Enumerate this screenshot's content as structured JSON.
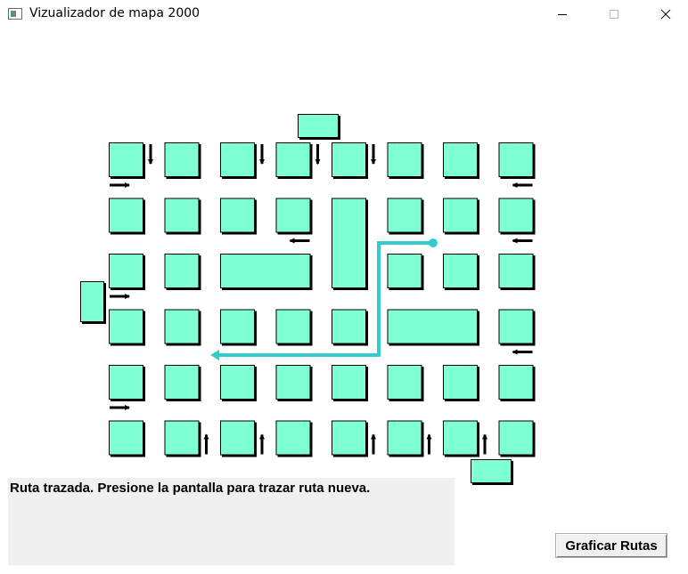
{
  "window": {
    "title": "Vizualizador de mapa 2000",
    "icon": "app-window-icon",
    "controls": [
      "minimize-icon",
      "maximize-icon",
      "close-icon"
    ]
  },
  "map": {
    "block_fill": "#7fffd4",
    "block_border": "#000000",
    "route_color": "#33cccc",
    "arrow_color": "#000000",
    "blocks": [
      {
        "id": "entrance-top",
        "c": [
          0.5,
          0.5
        ],
        "r": [
          -1,
          -1
        ]
      },
      {
        "id": "entrance-left",
        "c": [
          -0.5,
          -0.5
        ],
        "r": [
          2.5,
          3.5
        ]
      },
      {
        "id": "entrance-bottom",
        "c": [
          6.5,
          6.5
        ],
        "r": [
          6,
          6
        ]
      },
      {
        "id": "r0c0",
        "c": [
          0,
          0
        ],
        "r": [
          0,
          0
        ]
      },
      {
        "id": "r0c1",
        "c": [
          1,
          1
        ],
        "r": [
          0,
          0
        ]
      },
      {
        "id": "r0c2",
        "c": [
          2,
          2
        ],
        "r": [
          0,
          0
        ]
      },
      {
        "id": "r0c3",
        "c": [
          3,
          3
        ],
        "r": [
          0,
          0
        ]
      },
      {
        "id": "r0c4",
        "c": [
          4,
          4
        ],
        "r": [
          0,
          0
        ]
      },
      {
        "id": "r0c5",
        "c": [
          5,
          5
        ],
        "r": [
          0,
          0
        ]
      },
      {
        "id": "r0c6",
        "c": [
          6,
          6
        ],
        "r": [
          0,
          0
        ]
      },
      {
        "id": "r0c7",
        "c": [
          7,
          7
        ],
        "r": [
          0,
          0
        ]
      },
      {
        "id": "r1c0",
        "c": [
          0,
          0
        ],
        "r": [
          1,
          1
        ]
      },
      {
        "id": "r1c1",
        "c": [
          1,
          1
        ],
        "r": [
          1,
          1
        ]
      },
      {
        "id": "r1c2",
        "c": [
          2,
          2
        ],
        "r": [
          1,
          1
        ]
      },
      {
        "id": "r1c3",
        "c": [
          3,
          3
        ],
        "r": [
          1,
          1
        ]
      },
      {
        "id": "tall-c4",
        "c": [
          4,
          4
        ],
        "r": [
          1,
          2
        ]
      },
      {
        "id": "r1c5",
        "c": [
          5,
          5
        ],
        "r": [
          1,
          1
        ]
      },
      {
        "id": "r1c6",
        "c": [
          6,
          6
        ],
        "r": [
          1,
          1
        ]
      },
      {
        "id": "r1c7",
        "c": [
          7,
          7
        ],
        "r": [
          1,
          1
        ]
      },
      {
        "id": "r2c0",
        "c": [
          0,
          0
        ],
        "r": [
          2,
          2
        ]
      },
      {
        "id": "r2c1",
        "c": [
          1,
          1
        ],
        "r": [
          2,
          2
        ]
      },
      {
        "id": "wide-c2c3",
        "c": [
          2,
          3
        ],
        "r": [
          2,
          2
        ]
      },
      {
        "id": "r2c5",
        "c": [
          5,
          5
        ],
        "r": [
          2,
          2
        ]
      },
      {
        "id": "r2c6",
        "c": [
          6,
          6
        ],
        "r": [
          2,
          2
        ]
      },
      {
        "id": "r2c7",
        "c": [
          7,
          7
        ],
        "r": [
          2,
          2
        ]
      },
      {
        "id": "r3c0",
        "c": [
          0,
          0
        ],
        "r": [
          3,
          3
        ]
      },
      {
        "id": "r3c1",
        "c": [
          1,
          1
        ],
        "r": [
          3,
          3
        ]
      },
      {
        "id": "r3c2",
        "c": [
          2,
          2
        ],
        "r": [
          3,
          3
        ]
      },
      {
        "id": "r3c3",
        "c": [
          3,
          3
        ],
        "r": [
          3,
          3
        ]
      },
      {
        "id": "r3c4",
        "c": [
          4,
          4
        ],
        "r": [
          3,
          3
        ]
      },
      {
        "id": "wide-c5c6",
        "c": [
          5,
          6
        ],
        "r": [
          3,
          3
        ]
      },
      {
        "id": "r3c7",
        "c": [
          7,
          7
        ],
        "r": [
          3,
          3
        ]
      },
      {
        "id": "r4c0",
        "c": [
          0,
          0
        ],
        "r": [
          4,
          4
        ]
      },
      {
        "id": "r4c1",
        "c": [
          1,
          1
        ],
        "r": [
          4,
          4
        ]
      },
      {
        "id": "r4c2",
        "c": [
          2,
          2
        ],
        "r": [
          4,
          4
        ]
      },
      {
        "id": "r4c3",
        "c": [
          3,
          3
        ],
        "r": [
          4,
          4
        ]
      },
      {
        "id": "r4c4",
        "c": [
          4,
          4
        ],
        "r": [
          4,
          4
        ]
      },
      {
        "id": "r4c5",
        "c": [
          5,
          5
        ],
        "r": [
          4,
          4
        ]
      },
      {
        "id": "r4c6",
        "c": [
          6,
          6
        ],
        "r": [
          4,
          4
        ]
      },
      {
        "id": "r4c7",
        "c": [
          7,
          7
        ],
        "r": [
          4,
          4
        ]
      },
      {
        "id": "r5c0",
        "c": [
          0,
          0
        ],
        "r": [
          5,
          5
        ]
      },
      {
        "id": "r5c1",
        "c": [
          1,
          1
        ],
        "r": [
          5,
          5
        ]
      },
      {
        "id": "r5c2",
        "c": [
          2,
          2
        ],
        "r": [
          5,
          5
        ]
      },
      {
        "id": "r5c3",
        "c": [
          3,
          3
        ],
        "r": [
          5,
          5
        ]
      },
      {
        "id": "r5c4",
        "c": [
          4,
          4
        ],
        "r": [
          5,
          5
        ]
      },
      {
        "id": "r5c5",
        "c": [
          5,
          5
        ],
        "r": [
          5,
          5
        ]
      },
      {
        "id": "r5c6",
        "c": [
          6,
          6
        ],
        "r": [
          5,
          5
        ]
      },
      {
        "id": "r5c7",
        "c": [
          7,
          7
        ],
        "r": [
          5,
          5
        ]
      }
    ],
    "arrows": [
      {
        "dir": "down",
        "col": 0,
        "row": 0
      },
      {
        "dir": "down",
        "col": 2,
        "row": 0
      },
      {
        "dir": "down",
        "col": 3,
        "row": 0
      },
      {
        "dir": "down",
        "col": 4,
        "row": 0
      },
      {
        "dir": "right",
        "col": 0,
        "row": 0
      },
      {
        "dir": "left",
        "col": 7,
        "row": 0
      },
      {
        "dir": "left",
        "col": 3,
        "row": 1
      },
      {
        "dir": "left",
        "col": 7,
        "row": 1
      },
      {
        "dir": "right",
        "col": 0,
        "row": 2
      },
      {
        "dir": "left",
        "col": 7,
        "row": 3
      },
      {
        "dir": "right",
        "col": 0,
        "row": 4
      },
      {
        "dir": "up",
        "col": 1,
        "row": 5
      },
      {
        "dir": "up",
        "col": 2,
        "row": 5
      },
      {
        "dir": "up",
        "col": 4,
        "row": 5
      },
      {
        "dir": "up",
        "col": 5,
        "row": 5
      },
      {
        "dir": "up",
        "col": 6,
        "row": 5
      }
    ],
    "route": {
      "start": "street between row 1 and row 2, east of column 5",
      "path": [
        "east of column 5 / below row 1",
        "street between column 4 and 5",
        "street between row 3 and row 4",
        "west to column 1"
      ]
    }
  },
  "status": {
    "message": "Ruta trazada. Presione la pantalla para trazar ruta nueva."
  },
  "buttons": {
    "graph_routes": "Graficar Rutas"
  }
}
